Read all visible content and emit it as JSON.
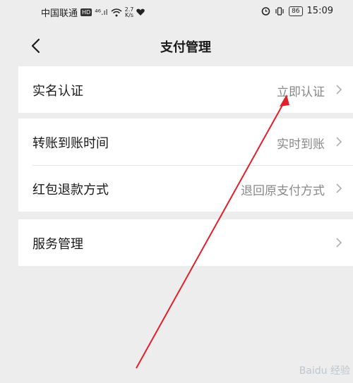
{
  "status_bar": {
    "carrier": "中国联通",
    "hd": "HD",
    "signal": "⁴⁶.ıl",
    "speed_value": "2.7",
    "speed_unit": "K/s",
    "battery": "86",
    "time": "15:09"
  },
  "header": {
    "title": "支付管理"
  },
  "rows": [
    {
      "label": "实名认证",
      "value": "立即认证"
    },
    {
      "label": "转账到账时间",
      "value": "实时到账"
    },
    {
      "label": "红包退款方式",
      "value": "退回原支付方式"
    },
    {
      "label": "服务管理",
      "value": ""
    }
  ],
  "watermark": "Baidu 经验",
  "colors": {
    "annotation_arrow": "#e0202a"
  }
}
